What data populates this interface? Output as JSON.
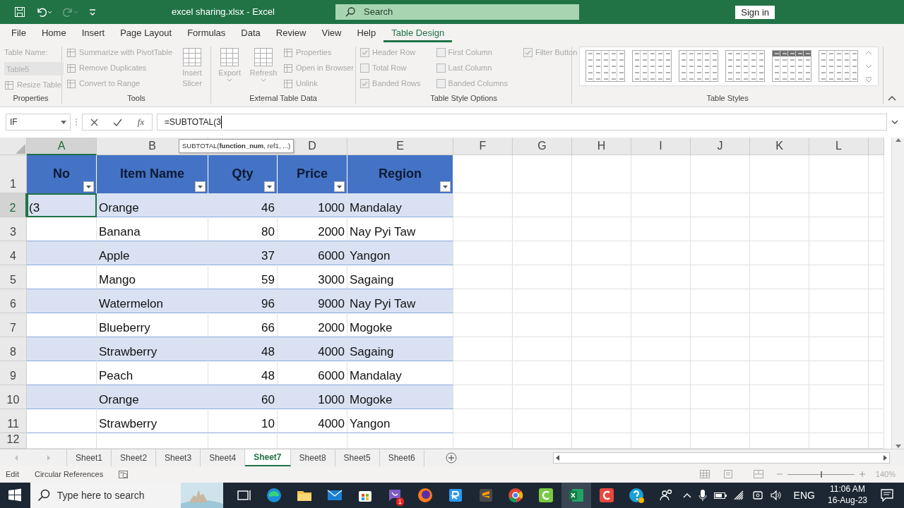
{
  "title_bar": {
    "title": "excel sharing.xlsx - Excel",
    "search": {
      "placeholder": "Search"
    },
    "sign_in": "Sign in"
  },
  "menu_tabs": [
    {
      "label": "File",
      "selected": false
    },
    {
      "label": "Home",
      "selected": false
    },
    {
      "label": "Insert",
      "selected": false
    },
    {
      "label": "Page Layout",
      "selected": false
    },
    {
      "label": "Formulas",
      "selected": false
    },
    {
      "label": "Data",
      "selected": false
    },
    {
      "label": "Review",
      "selected": false
    },
    {
      "label": "View",
      "selected": false
    },
    {
      "label": "Help",
      "selected": false
    },
    {
      "label": "Table Design",
      "selected": true
    }
  ],
  "ribbon": {
    "groups": [
      {
        "label": "Properties",
        "columns": [
          [
            {
              "kind": "label",
              "text": "Table Name:",
              "disabled": true
            },
            {
              "kind": "field",
              "value": "Table5",
              "disabled": true
            },
            {
              "kind": "command",
              "text": "Resize Table",
              "disabled": true
            }
          ]
        ]
      },
      {
        "label": "Tools",
        "columns": [
          [
            {
              "kind": "command",
              "text": "Summarize with PivotTable",
              "disabled": true
            },
            {
              "kind": "command",
              "text": "Remove Duplicates",
              "disabled": true
            },
            {
              "kind": "command",
              "text": "Convert to Range",
              "disabled": true
            }
          ],
          [
            {
              "kind": "large",
              "text": "Insert Slicer",
              "disabled": true,
              "dropdown": false
            }
          ]
        ]
      },
      {
        "label": "External Table Data",
        "columns": [
          [
            {
              "kind": "large",
              "text": "Export",
              "disabled": true,
              "dropdown": true
            }
          ],
          [
            {
              "kind": "large",
              "text": "Refresh",
              "disabled": true,
              "dropdown": true
            }
          ],
          [
            {
              "kind": "command",
              "text": "Properties",
              "disabled": true
            },
            {
              "kind": "command",
              "text": "Open in Browser",
              "disabled": true
            },
            {
              "kind": "command",
              "text": "Unlink",
              "disabled": true
            }
          ]
        ]
      },
      {
        "label": "Table Style Options",
        "columns": [
          [
            {
              "kind": "checkbox",
              "text": "Header Row",
              "checked": true,
              "disabled": true
            },
            {
              "kind": "checkbox",
              "text": "Total Row",
              "checked": false,
              "disabled": true
            },
            {
              "kind": "checkbox",
              "text": "Banded Rows",
              "checked": true,
              "disabled": true
            }
          ],
          [
            {
              "kind": "checkbox",
              "text": "First Column",
              "checked": false,
              "disabled": true
            },
            {
              "kind": "checkbox",
              "text": "Last Column",
              "checked": false,
              "disabled": true
            },
            {
              "kind": "checkbox",
              "text": "Banded Columns",
              "checked": false,
              "disabled": true
            }
          ],
          [
            {
              "kind": "checkbox",
              "text": "Filter Button",
              "checked": true,
              "disabled": true
            }
          ]
        ]
      },
      {
        "label": "Table Styles",
        "columns": [
          [
            {
              "kind": "gallery"
            }
          ]
        ]
      }
    ]
  },
  "formula_bar": {
    "name_box": "IF",
    "function_button": "fx",
    "formula": "=SUBTOTAL(3",
    "tooltip": "SUBTOTAL(**function_num**, ref1, ...)"
  },
  "sheet": {
    "columns": [
      {
        "label": "A",
        "selected": true
      },
      {
        "label": "B",
        "selected": false
      },
      {
        "selected": false
      },
      {
        "label": "D",
        "selected": false
      },
      {
        "label": "E",
        "selected": false
      },
      {
        "label": "F",
        "selected": false
      },
      {
        "label": "G",
        "selected": false
      },
      {
        "label": "H",
        "selected": false
      },
      {
        "label": "I",
        "selected": false
      },
      {
        "label": "J",
        "selected": false
      },
      {
        "label": "K",
        "selected": false
      },
      {
        "label": "L",
        "selected": false
      }
    ],
    "rows": [
      {
        "label": "1",
        "selected": false
      },
      {
        "label": "2",
        "selected": true
      },
      {
        "label": "3",
        "selected": false
      },
      {
        "label": "4",
        "selected": false
      },
      {
        "label": "5",
        "selected": false
      },
      {
        "label": "6",
        "selected": false
      },
      {
        "label": "7",
        "selected": false
      },
      {
        "label": "8",
        "selected": false
      },
      {
        "label": "9",
        "selected": false
      },
      {
        "label": "10",
        "selected": false
      },
      {
        "label": "11",
        "selected": false
      },
      {
        "label": "12",
        "selected": false
      }
    ],
    "table": {
      "headers": [
        "No",
        "Item Name",
        "Qty",
        "Price",
        "Region"
      ],
      "rows": [
        {
          "no": "(3",
          "item_name": "Orange",
          "qty": "46",
          "price": "1000",
          "region": "Mandalay"
        },
        {
          "item_name": "Banana",
          "qty": "80",
          "price": "2000",
          "region": "Nay Pyi Taw"
        },
        {
          "item_name": "Apple",
          "qty": "37",
          "price": "6000",
          "region": "Yangon"
        },
        {
          "item_name": "Mango",
          "qty": "59",
          "price": "3000",
          "region": "Sagaing"
        },
        {
          "item_name": "Watermelon",
          "qty": "96",
          "price": "9000",
          "region": "Nay Pyi Taw"
        },
        {
          "item_name": "Blueberry",
          "qty": "66",
          "price": "2000",
          "region": "Mogoke"
        },
        {
          "item_name": "Strawberry",
          "qty": "48",
          "price": "4000",
          "region": "Sagaing"
        },
        {
          "item_name": "Peach",
          "qty": "48",
          "price": "6000",
          "region": "Mandalay"
        },
        {
          "item_name": "Orange",
          "qty": "60",
          "price": "1000",
          "region": "Mogoke"
        },
        {
          "item_name": "Strawberry",
          "qty": "10",
          "price": "4000",
          "region": "Yangon"
        }
      ]
    }
  },
  "sheet_tabs": [
    {
      "label": "Sheet1",
      "selected": false
    },
    {
      "label": "Sheet2",
      "selected": false
    },
    {
      "label": "Sheet3",
      "selected": false
    },
    {
      "label": "Sheet4",
      "selected": false
    },
    {
      "label": "Sheet7",
      "selected": true
    },
    {
      "label": "Sheet8",
      "selected": false
    },
    {
      "label": "Sheet5",
      "selected": false
    },
    {
      "label": "Sheet6",
      "selected": false
    }
  ],
  "status_bar": {
    "mode": "Edit",
    "circular_references": "Circular References",
    "zoom": "140%",
    "zoom_slider": {
      "level": 0.5
    }
  },
  "taskbar": {
    "search": {
      "placeholder": "Type here to search"
    },
    "badge": "1",
    "language": "ENG",
    "time": "11:06 AM",
    "date": "16-Aug-23"
  }
}
